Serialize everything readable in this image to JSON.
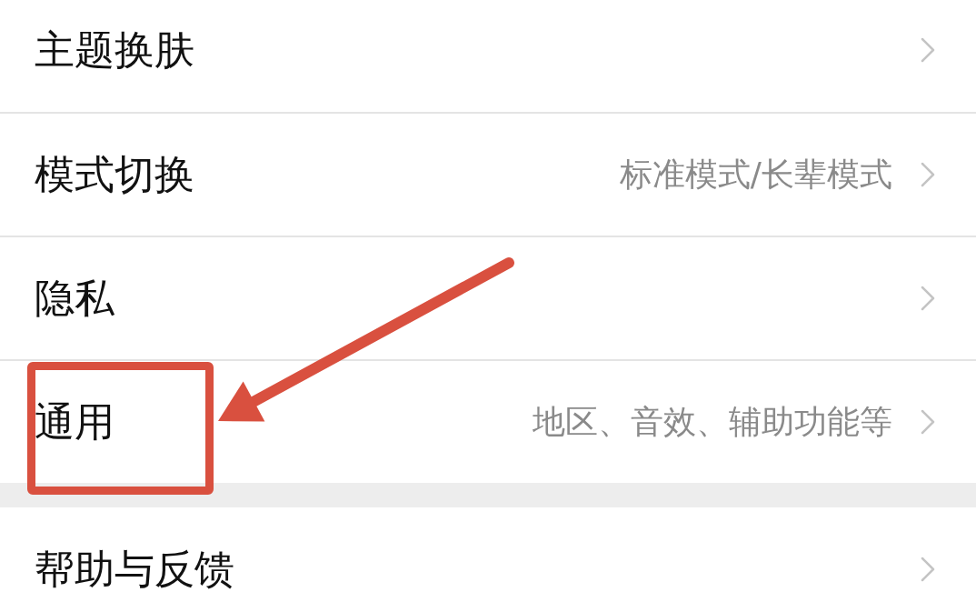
{
  "groups": [
    {
      "items": [
        {
          "label": "主题换肤",
          "highlighted": false
        },
        {
          "label": "模式切换",
          "value": "标准模式/长辈模式",
          "highlighted": false
        },
        {
          "label": "隐私",
          "highlighted": false
        },
        {
          "label": "通用",
          "value": "地区、音效、辅助功能等",
          "highlighted": true
        }
      ]
    },
    {
      "items": [
        {
          "label": "帮助与反馈",
          "highlighted": false
        }
      ]
    }
  ]
}
